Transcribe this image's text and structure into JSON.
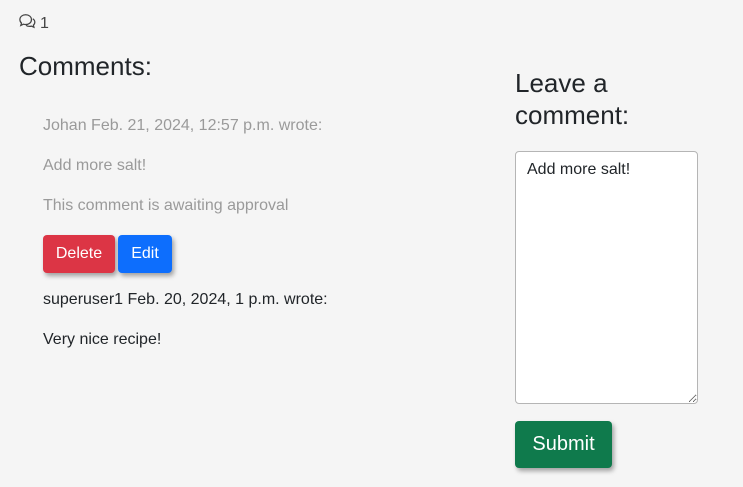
{
  "comment_count": "1",
  "comments_heading": "Comments:",
  "comments": [
    {
      "header": "Johan Feb. 21, 2024, 12:57 p.m. wrote:",
      "body": "Add more salt!",
      "status": "This comment is awaiting approval"
    },
    {
      "header": "superuser1 Feb. 20, 2024, 1 p.m. wrote:",
      "body": "Very nice recipe!"
    }
  ],
  "actions": {
    "delete_label": "Delete",
    "edit_label": "Edit"
  },
  "form": {
    "heading": "Leave a comment:",
    "textarea_value": "Add more salt!",
    "submit_label": "Submit"
  },
  "colors": {
    "delete": "#dc3545",
    "edit": "#0d6efd",
    "submit": "#0f7a4c"
  }
}
